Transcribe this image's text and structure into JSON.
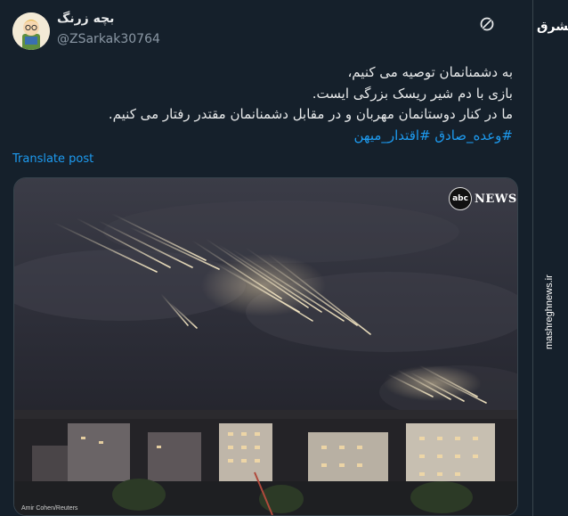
{
  "author": {
    "display_name": "بچه زرنگ",
    "handle": "@ZSarkak30764"
  },
  "tweet": {
    "lines": [
      "به دشمنانمان توصیه می کنیم،",
      "بازی با دم شیر ریسک بزرگی ایست.",
      "ما در کنار دوستانمان مهربان و در مقابل دشمنانمان مقتدر رفتار می کنیم."
    ],
    "hashtags": "#وعده_صادق #اقتدار_میهن",
    "translate_label": "Translate post"
  },
  "media": {
    "logo_circle": "abc",
    "logo_text": "NEWS",
    "credit": "Amir Cohen/Reuters",
    "description_icon": "night-sky-interceptions-photo"
  },
  "watermark": {
    "logo": "مشرق",
    "url": "mashreghnews.ir"
  },
  "colors": {
    "background": "#15202b",
    "accent": "#1d9bf0",
    "muted": "#8b98a5"
  }
}
